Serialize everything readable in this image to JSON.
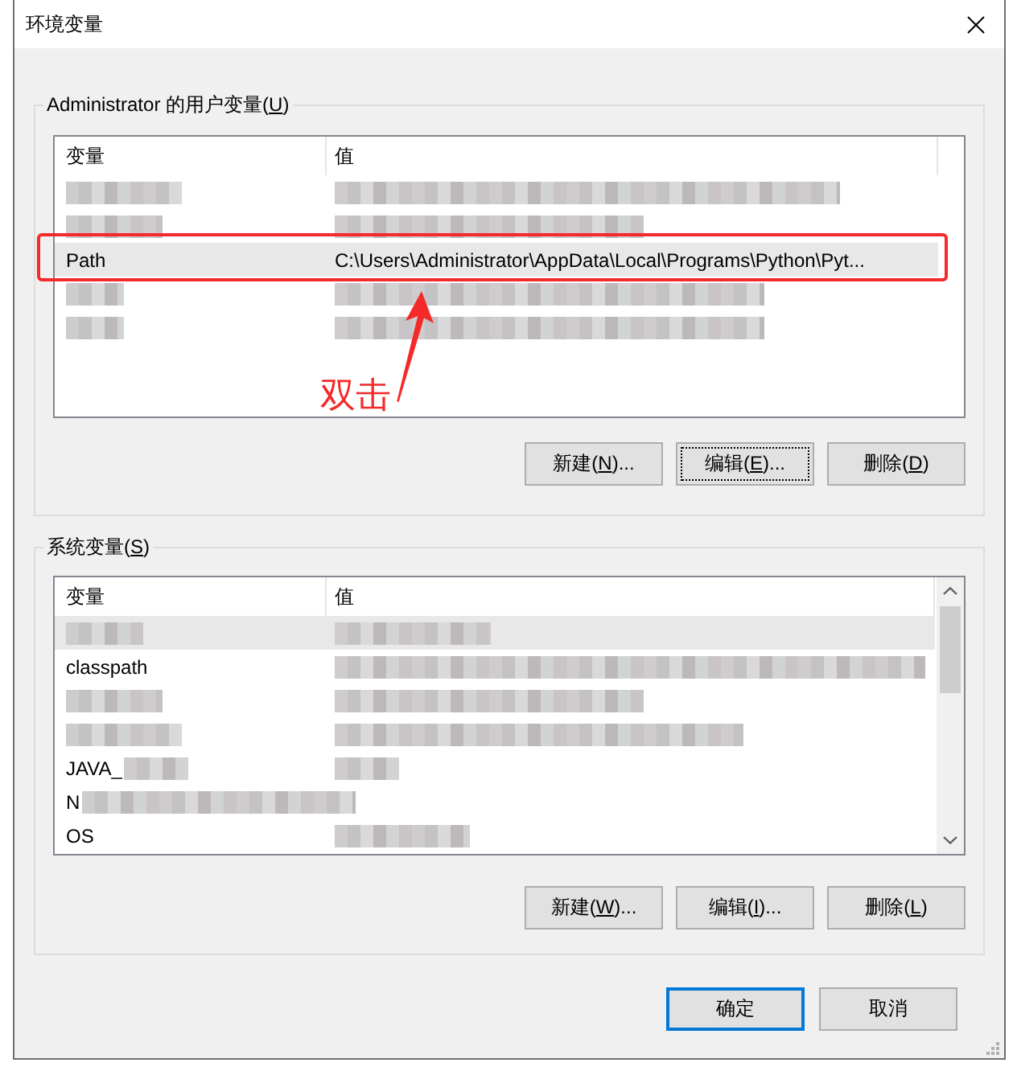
{
  "window": {
    "title": "环境变量"
  },
  "user_variables": {
    "label": {
      "before": "Administrator 的用户变量(",
      "key": "U",
      "after": ")"
    },
    "columns": [
      "变量",
      "值"
    ],
    "rows": [
      {
        "selected": false,
        "variable_blurred": true,
        "value_blurred": true
      },
      {
        "selected": false,
        "variable_blurred": true,
        "value_blurred": true
      },
      {
        "selected": true,
        "variable": "Path",
        "variable_blurred": false,
        "value": "C:\\Users\\Administrator\\AppData\\Local\\Programs\\Python\\Pyt...",
        "value_blurred": false
      },
      {
        "selected": false,
        "variable_blurred": true,
        "value_blurred": true
      },
      {
        "selected": false,
        "variable_blurred": true,
        "value_blurred": true
      }
    ],
    "buttons": [
      {
        "label": {
          "before": "新建(",
          "key": "N",
          "after": ")..."
        },
        "focused": false
      },
      {
        "label": {
          "before": "编辑(",
          "key": "E",
          "after": ")..."
        },
        "focused": true
      },
      {
        "label": {
          "before": "删除(",
          "key": "D",
          "after": ")"
        },
        "focused": false
      }
    ]
  },
  "annotation": {
    "label": "双击"
  },
  "system_variables": {
    "label": {
      "before": "系统变量(",
      "key": "S",
      "after": ")"
    },
    "columns": [
      "变量",
      "值"
    ],
    "rows": [
      {
        "selected": true,
        "variable_blurred": true,
        "value_blurred": true
      },
      {
        "selected": false,
        "variable": "classpath",
        "variable_blurred": false,
        "value_blurred": true
      },
      {
        "selected": false,
        "variable_blurred": true,
        "value_blurred": true
      },
      {
        "selected": false,
        "variable_blurred": true,
        "value_blurred": true
      },
      {
        "selected": false,
        "variable": "JAVA_",
        "variable_blurred": true,
        "value_blurred": true
      },
      {
        "selected": false,
        "variable": "N",
        "variable_blurred": true,
        "value_blurred": false
      },
      {
        "selected": false,
        "variable": "OS",
        "variable_blurred": false,
        "value_blurred": true
      }
    ],
    "buttons": [
      {
        "label": {
          "before": "新建(",
          "key": "W",
          "after": ")..."
        },
        "focused": false
      },
      {
        "label": {
          "before": "编辑(",
          "key": "I",
          "after": ")..."
        },
        "focused": false
      },
      {
        "label": {
          "before": "删除(",
          "key": "L",
          "after": ")"
        },
        "focused": false
      }
    ]
  },
  "dialog_buttons": [
    {
      "label": "确定",
      "default": true
    },
    {
      "label": "取消",
      "default": false
    }
  ]
}
